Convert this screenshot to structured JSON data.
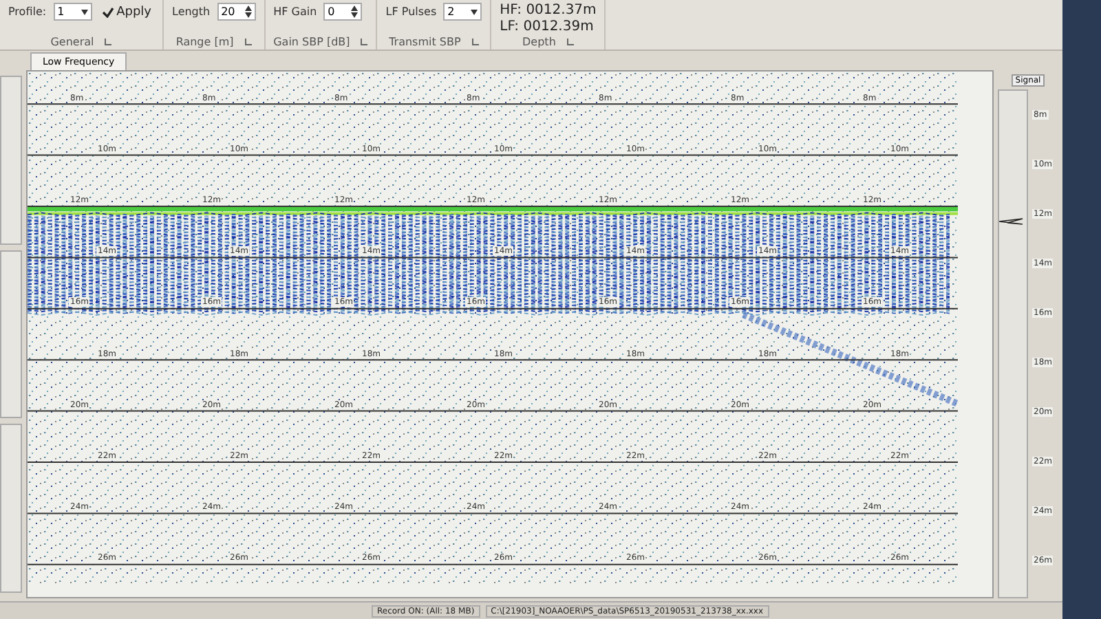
{
  "ribbon": {
    "groups": [
      {
        "caption": "General",
        "controls": [
          {
            "kind": "select",
            "label": "Profile:",
            "value": "1"
          },
          {
            "kind": "button",
            "label": "Apply"
          }
        ]
      },
      {
        "caption": "Range [m]",
        "controls": [
          {
            "kind": "spinner",
            "label": "Length",
            "value": "20"
          }
        ]
      },
      {
        "caption": "Gain SBP [dB]",
        "controls": [
          {
            "kind": "spinner",
            "label": "HF Gain",
            "value": "0"
          }
        ]
      },
      {
        "caption": "Transmit SBP",
        "controls": [
          {
            "kind": "select",
            "label": "LF Pulses",
            "value": "2"
          }
        ]
      },
      {
        "caption": "Depth",
        "controls": [
          {
            "kind": "readout",
            "label": "HF:",
            "value": "0012.37m"
          },
          {
            "kind": "readout",
            "label": "LF:",
            "value": "0012.39m"
          }
        ]
      }
    ]
  },
  "tabs": [
    {
      "label": "Low Frequency",
      "selected": true
    }
  ],
  "depth_lines": [
    {
      "labels": [
        "8m",
        "8m",
        "8m",
        "8m",
        "8m",
        "8m",
        "8m"
      ]
    },
    {
      "labels": [
        "10m",
        "10m",
        "10m",
        "10m",
        "10m",
        "10m",
        "10m"
      ]
    },
    {
      "labels": [
        "12m",
        "12m",
        "12m",
        "12m",
        "12m",
        "12m",
        "12m"
      ]
    },
    {
      "labels": [
        "14m",
        "14m",
        "14m",
        "14m",
        "14m",
        "14m",
        "14m"
      ]
    },
    {
      "labels": [
        "16m",
        "16m",
        "16m",
        "16m",
        "16m",
        "16m",
        "16m"
      ]
    },
    {
      "labels": [
        "18m",
        "18m",
        "18m",
        "18m",
        "18m",
        "18m",
        "18m"
      ]
    },
    {
      "labels": [
        "20m",
        "20m",
        "20m",
        "20m",
        "20m",
        "20m",
        "20m"
      ]
    },
    {
      "labels": [
        "22m",
        "22m",
        "22m",
        "22m",
        "22m",
        "22m",
        "22m"
      ]
    },
    {
      "labels": [
        "24m",
        "24m",
        "24m",
        "24m",
        "24m",
        "24m",
        "24m"
      ]
    },
    {
      "labels": [
        "26m",
        "26m",
        "26m",
        "26m",
        "26m",
        "26m",
        "26m"
      ]
    }
  ],
  "signal_panel": {
    "title": "Signal",
    "scale": [
      "8m",
      "10m",
      "12m",
      "14m",
      "16m",
      "18m",
      "20m",
      "22m",
      "24m",
      "26m"
    ]
  },
  "status_bar": {
    "record": "Record ON: (All: 18 MB)",
    "file": "C:\\[21903]_NOAAOER\\PS_data\\SP6513_20190531_213738_xx.xxx"
  }
}
